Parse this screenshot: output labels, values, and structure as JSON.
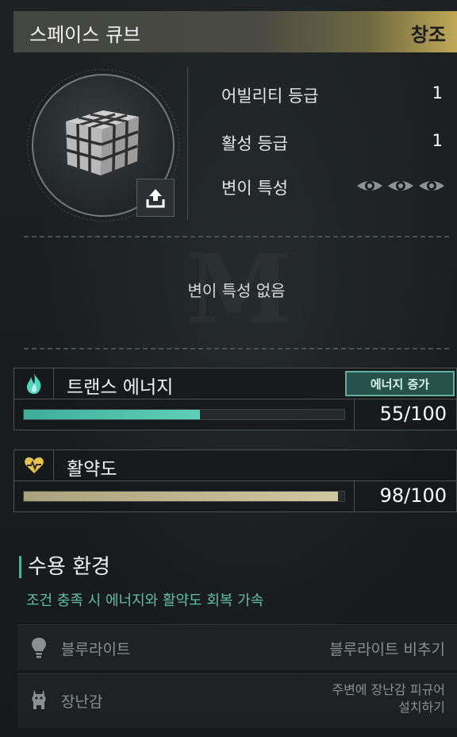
{
  "header": {
    "title": "스페이스 큐브",
    "rank": "창조"
  },
  "stats": {
    "ability_grade_label": "어빌리티 등급",
    "ability_grade_value": "1",
    "active_grade_label": "활성 등급",
    "active_grade_value": "1",
    "mutation_label": "변이 특성"
  },
  "icons": {
    "share": "share-upload-icon",
    "eye": "eye-icon",
    "flame": "flame-icon",
    "heart": "heart-pulse-icon",
    "bulb": "lightbulb-icon",
    "figure": "llama-figure-icon",
    "cube": "rubik-cube-icon"
  },
  "mutation_empty": "변이 특성 없음",
  "energy": {
    "title": "트랜스 에너지",
    "boost_label": "에너지 증가",
    "value_text": "55/100",
    "fraction": 0.55,
    "color": "#5fd0b8"
  },
  "vitality": {
    "title": "활약도",
    "value_text": "98/100",
    "fraction": 0.98,
    "color": "#cfc7a0"
  },
  "environment": {
    "title": "수용 환경",
    "subtitle": "조건 충족 시 에너지와 활약도 회복 가속",
    "items": [
      {
        "name": "블루라이트",
        "condition": "블루라이트 비추기"
      },
      {
        "name": "장난감",
        "condition_line1": "주변에 장난감 피규어",
        "condition_line2": "설치하기"
      }
    ]
  },
  "colors": {
    "accent": "#5fb0a0",
    "gold": "#c8b05a"
  }
}
